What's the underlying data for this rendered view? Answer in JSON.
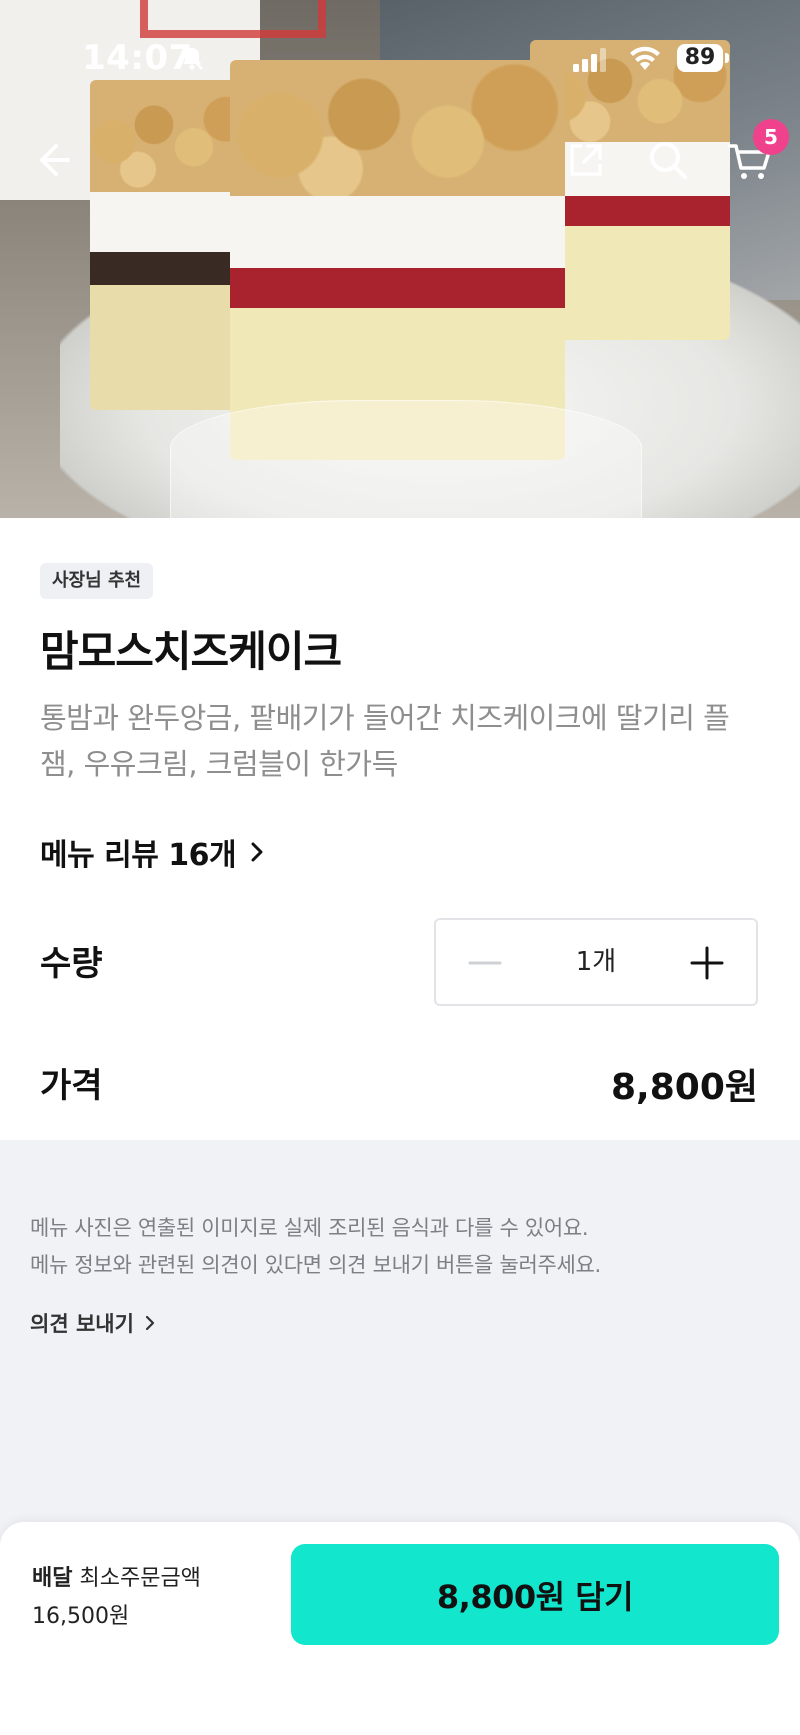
{
  "status_bar": {
    "time": "14:07",
    "battery": "89",
    "icons": [
      "bell-slash-icon",
      "signal-icon",
      "wifi-icon",
      "battery-icon"
    ]
  },
  "header": {
    "icons": [
      "back-arrow-icon",
      "share-icon",
      "search-icon",
      "cart-icon"
    ],
    "cart_badge": "5"
  },
  "menu": {
    "tag": "사장님 추천",
    "title": "맘모스치즈케이크",
    "description": "통밤과 완두앙금, 팥배기가 들어간 치즈케이크에 딸기리 플잼, 우유크림, 크럼블이 한가득",
    "review_link": "메뉴 리뷰 16개"
  },
  "quantity": {
    "label": "수량",
    "value": "1개"
  },
  "price": {
    "label": "가격",
    "value": "8,800원"
  },
  "notice": {
    "line1": "메뉴 사진은 연출된 이미지로 실제 조리된 음식과 다를 수 있어요.",
    "line2": "메뉴 정보와 관련된 의견이 있다면 의견 보내기 버튼을 눌러주세요.",
    "feedback_link": "의견 보내기"
  },
  "bottom_bar": {
    "delivery_label": "배달",
    "min_order_label": "최소주문금액",
    "min_order_value": "16,500원",
    "cta_label": "8,800원 담기"
  },
  "colors": {
    "accent": "#12e6cd",
    "badge": "#f0418d",
    "info_bg": "#f1f2f5"
  }
}
